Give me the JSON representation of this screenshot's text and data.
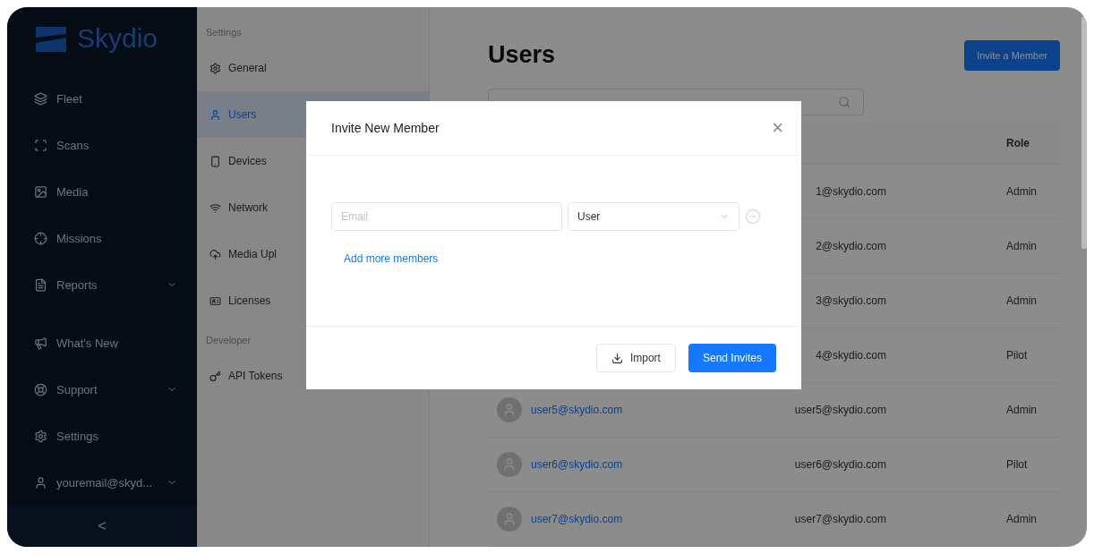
{
  "sidebar": {
    "logo": "Skydio",
    "items": [
      {
        "label": "Fleet",
        "expandable": false
      },
      {
        "label": "Scans",
        "expandable": false
      },
      {
        "label": "Media",
        "expandable": false
      },
      {
        "label": "Missions",
        "expandable": false
      },
      {
        "label": "Reports",
        "expandable": true
      }
    ],
    "bottom_items": [
      {
        "label": "What's New",
        "expandable": false
      },
      {
        "label": "Support",
        "expandable": true
      },
      {
        "label": "Settings",
        "expandable": false
      },
      {
        "label": "youremail@skyd...",
        "expandable": true
      }
    ],
    "collapse": "<"
  },
  "settings_nav": [
    {
      "kind": "heading",
      "label": "Settings"
    },
    {
      "kind": "item",
      "label": "General",
      "selected": false
    },
    {
      "kind": "item",
      "label": "Users",
      "selected": true
    },
    {
      "kind": "item",
      "label": "Devices",
      "selected": false
    },
    {
      "kind": "item",
      "label": "Network",
      "selected": false
    },
    {
      "kind": "item",
      "label": "Media Upl",
      "selected": false
    },
    {
      "kind": "item",
      "label": "Licenses",
      "selected": false
    },
    {
      "kind": "heading",
      "label": "Developer"
    },
    {
      "kind": "item",
      "label": "API Tokens",
      "selected": false
    }
  ],
  "page": {
    "title": "Users",
    "action": "Invite a Member",
    "table": {
      "columns": [
        "Role"
      ],
      "rows": [
        {
          "email": "1@skydio.com",
          "role": "Admin"
        },
        {
          "email": "2@skydio.com",
          "role": "Admin"
        },
        {
          "email": "3@skydio.com",
          "role": "Admin"
        },
        {
          "email": "4@skydio.com",
          "role": "Pilot"
        },
        {
          "name": "user5@skydio.com",
          "email": "user5@skydio.com",
          "role": "Admin"
        },
        {
          "name": "user6@skydio.com",
          "email": "user6@skydio.com",
          "role": "Pilot"
        },
        {
          "name": "user7@skydio.com",
          "email": "user7@skydio.com",
          "role": "Admin"
        }
      ]
    }
  },
  "modal": {
    "title": "Invite New Member",
    "close": "×",
    "email": {
      "placeholder": "Email"
    },
    "role": {
      "value": "User"
    },
    "add_more": "Add more members",
    "buttons": [
      {
        "kind": "secondary",
        "label": "Import"
      },
      {
        "kind": "primary",
        "label": "Send Invites"
      }
    ]
  }
}
